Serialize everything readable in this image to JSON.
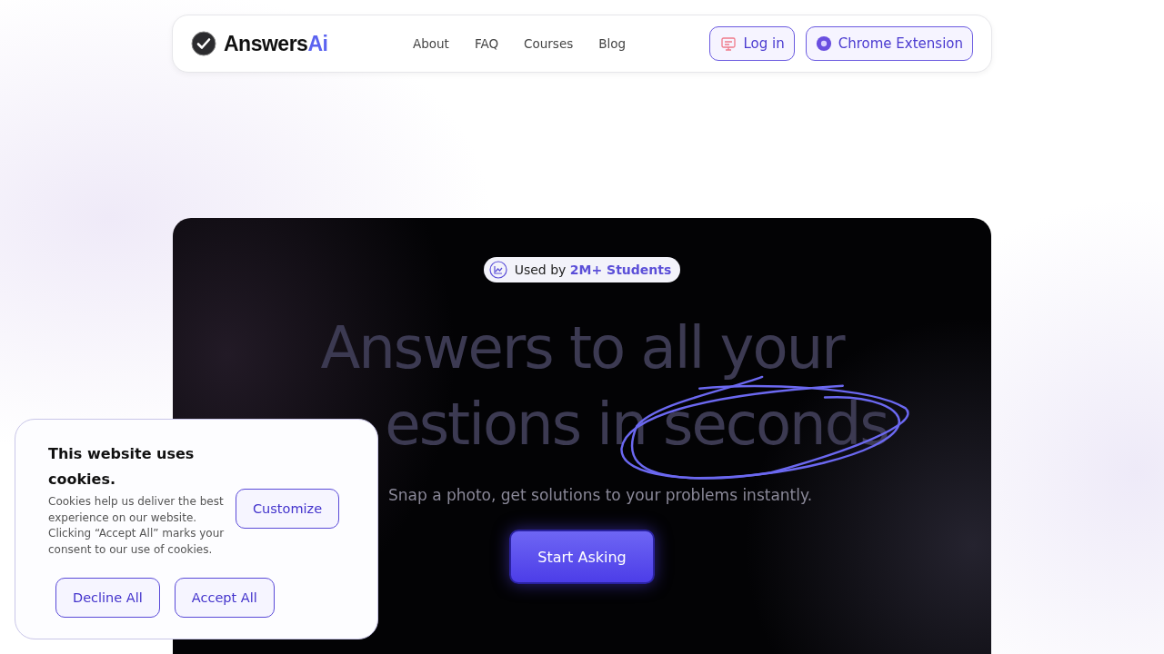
{
  "nav": {
    "logo_main": "Answers",
    "logo_accent": "Ai",
    "links": [
      "About",
      "FAQ",
      "Courses",
      "Blog"
    ],
    "login": "Log in",
    "extension": "Chrome Extension"
  },
  "hero": {
    "badge_prefix": "Used by",
    "badge_highlight": "2M+ Students",
    "headline_lines": [
      "Answers to all your",
      "estions in seconds"
    ],
    "subtitle": "Snap a photo, get solutions to your problems instantly.",
    "cta": "Start Asking"
  },
  "cookie_banner": {
    "title": "This website uses cookies.",
    "text": "Cookies help us deliver the best experience on our website. Clicking “Accept All” marks your consent to our use of cookies.",
    "customize": "Customize",
    "decline": "Decline All",
    "accept": "Accept All"
  }
}
